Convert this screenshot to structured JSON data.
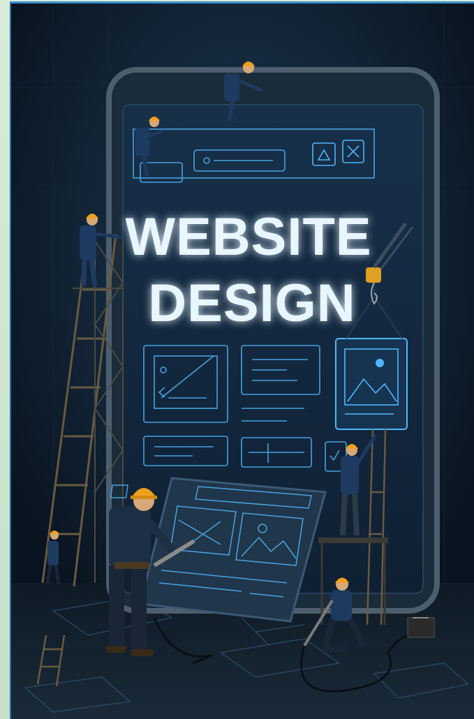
{
  "illustration": {
    "headline_line1": "WEBSITE",
    "headline_line2": "DESIGN",
    "colors": {
      "background": "#0b1520",
      "screen": "#14263a",
      "neon": "#4fb8ff",
      "helmet": "#f0a020",
      "frame_border": "#3a8fd0"
    },
    "icons": [
      "tablet-device-icon",
      "worker-figure-icon",
      "ladder-icon",
      "crane-hook-icon",
      "image-placeholder-icon",
      "close-icon",
      "triangle-icon"
    ]
  }
}
